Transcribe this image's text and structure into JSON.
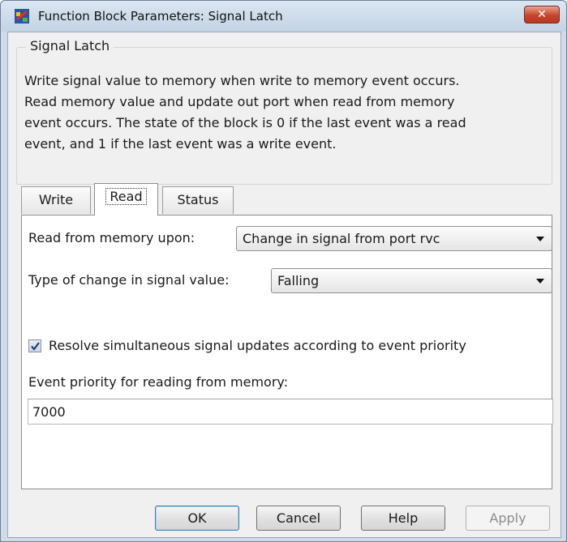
{
  "window": {
    "title": "Function Block Parameters: Signal Latch",
    "close_label": "✕"
  },
  "group": {
    "legend": "Signal Latch",
    "description": "Write signal value to memory when write to memory event occurs.\nRead memory value and update out port when read from memory\nevent occurs. The state of the block is 0 if the last event was a read\nevent, and 1 if the last event was a write event."
  },
  "tabs": [
    {
      "label": "Write",
      "active": false
    },
    {
      "label": "Read",
      "active": true
    },
    {
      "label": "Status",
      "active": false
    }
  ],
  "read_panel": {
    "read_upon_label": "Read from memory upon:",
    "read_upon_value": "Change in signal from port rvc",
    "change_type_label": "Type of change in signal value:",
    "change_type_value": "Falling",
    "resolve_label": "Resolve simultaneous signal updates according to event priority",
    "resolve_checked": true,
    "priority_label": "Event priority for reading from memory:",
    "priority_value": "7000"
  },
  "buttons": {
    "ok": "OK",
    "cancel": "Cancel",
    "help": "Help",
    "apply": "Apply"
  },
  "colors": {
    "title_gradient": "#c3d3e4",
    "close_button": "#c7442a",
    "panel_background": "#f0f0f0"
  }
}
